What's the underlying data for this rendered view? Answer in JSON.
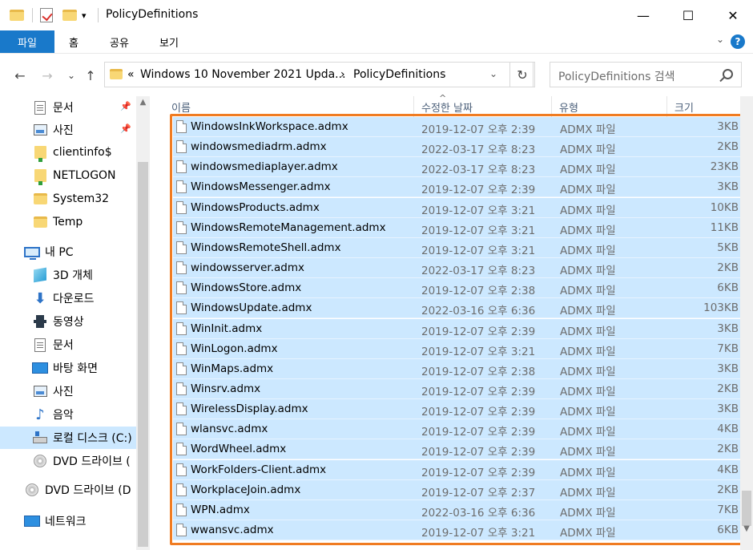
{
  "window": {
    "title": "PolicyDefinitions",
    "minimize": "—",
    "maximize": "☐",
    "close": "✕"
  },
  "ribbon": {
    "tabs": [
      "파일",
      "홈",
      "공유",
      "보기"
    ],
    "collapse": "⌄",
    "help": "?"
  },
  "address": {
    "overflow": "«",
    "segments": [
      "Windows 10 November 2021 Upda...",
      "›",
      "PolicyDefinitions"
    ],
    "dropdown": "⌄",
    "refresh": "↻",
    "search_placeholder": "PolicyDefinitions 검색"
  },
  "nav": {
    "back": "←",
    "forward": "→",
    "recent": "⌄",
    "up": "↑"
  },
  "sidebar": {
    "items": [
      {
        "label": "문서",
        "icon": "document-icon",
        "pinned": true
      },
      {
        "label": "사진",
        "icon": "pictures-icon",
        "pinned": true
      },
      {
        "label": "clientinfo$",
        "icon": "network-folder-icon"
      },
      {
        "label": "NETLOGON",
        "icon": "network-folder-icon"
      },
      {
        "label": "System32",
        "icon": "folder-icon"
      },
      {
        "label": "Temp",
        "icon": "folder-icon"
      },
      {
        "label": "내 PC",
        "icon": "pc-icon"
      },
      {
        "label": "3D 개체",
        "icon": "3d-objects-icon"
      },
      {
        "label": "다운로드",
        "icon": "download-icon"
      },
      {
        "label": "동영상",
        "icon": "video-icon"
      },
      {
        "label": "문서",
        "icon": "document-icon"
      },
      {
        "label": "바탕 화면",
        "icon": "desktop-icon"
      },
      {
        "label": "사진",
        "icon": "pictures-icon"
      },
      {
        "label": "음악",
        "icon": "music-icon"
      },
      {
        "label": "로컬 디스크 (C:)",
        "icon": "local-disk-icon",
        "selected": true
      },
      {
        "label": "DVD 드라이브 (",
        "icon": "dvd-drive-icon"
      },
      {
        "label": "DVD 드라이브 (D",
        "icon": "dvd-drive-icon"
      },
      {
        "label": "네트워크",
        "icon": "network-icon"
      }
    ],
    "pin_glyph": "📌"
  },
  "columns": {
    "name": "이름",
    "date": "수정한 날짜",
    "type": "유형",
    "size": "크기"
  },
  "files": [
    {
      "name": "WindowsInkWorkspace.admx",
      "date": "2019-12-07 오후 2:39",
      "type": "ADMX 파일",
      "size": "3KB"
    },
    {
      "name": "windowsmediadrm.admx",
      "date": "2022-03-17 오후 8:23",
      "type": "ADMX 파일",
      "size": "2KB"
    },
    {
      "name": "windowsmediaplayer.admx",
      "date": "2022-03-17 오후 8:23",
      "type": "ADMX 파일",
      "size": "23KB"
    },
    {
      "name": "WindowsMessenger.admx",
      "date": "2019-12-07 오후 2:39",
      "type": "ADMX 파일",
      "size": "3KB"
    },
    {
      "name": "WindowsProducts.admx",
      "date": "2019-12-07 오후 3:21",
      "type": "ADMX 파일",
      "size": "10KB"
    },
    {
      "name": "WindowsRemoteManagement.admx",
      "date": "2019-12-07 오후 3:21",
      "type": "ADMX 파일",
      "size": "11KB"
    },
    {
      "name": "WindowsRemoteShell.admx",
      "date": "2019-12-07 오후 3:21",
      "type": "ADMX 파일",
      "size": "5KB"
    },
    {
      "name": "windowsserver.admx",
      "date": "2022-03-17 오후 8:23",
      "type": "ADMX 파일",
      "size": "2KB"
    },
    {
      "name": "WindowsStore.admx",
      "date": "2019-12-07 오후 2:38",
      "type": "ADMX 파일",
      "size": "6KB"
    },
    {
      "name": "WindowsUpdate.admx",
      "date": "2022-03-16 오후 6:36",
      "type": "ADMX 파일",
      "size": "103KB"
    },
    {
      "name": "WinInit.admx",
      "date": "2019-12-07 오후 2:39",
      "type": "ADMX 파일",
      "size": "3KB"
    },
    {
      "name": "WinLogon.admx",
      "date": "2019-12-07 오후 3:21",
      "type": "ADMX 파일",
      "size": "7KB"
    },
    {
      "name": "WinMaps.admx",
      "date": "2019-12-07 오후 2:38",
      "type": "ADMX 파일",
      "size": "3KB"
    },
    {
      "name": "Winsrv.admx",
      "date": "2019-12-07 오후 2:39",
      "type": "ADMX 파일",
      "size": "2KB"
    },
    {
      "name": "WirelessDisplay.admx",
      "date": "2019-12-07 오후 2:39",
      "type": "ADMX 파일",
      "size": "3KB"
    },
    {
      "name": "wlansvc.admx",
      "date": "2019-12-07 오후 2:39",
      "type": "ADMX 파일",
      "size": "4KB"
    },
    {
      "name": "WordWheel.admx",
      "date": "2019-12-07 오후 2:39",
      "type": "ADMX 파일",
      "size": "2KB"
    },
    {
      "name": "WorkFolders-Client.admx",
      "date": "2019-12-07 오후 2:39",
      "type": "ADMX 파일",
      "size": "4KB"
    },
    {
      "name": "WorkplaceJoin.admx",
      "date": "2019-12-07 오후 2:37",
      "type": "ADMX 파일",
      "size": "2KB"
    },
    {
      "name": "WPN.admx",
      "date": "2022-03-16 오후 6:36",
      "type": "ADMX 파일",
      "size": "7KB"
    },
    {
      "name": "wwansvc.admx",
      "date": "2019-12-07 오후 3:21",
      "type": "ADMX 파일",
      "size": "6KB"
    }
  ],
  "colors": {
    "accent": "#1979ca",
    "selection": "#cce8ff",
    "highlight_box": "#f07c22"
  }
}
